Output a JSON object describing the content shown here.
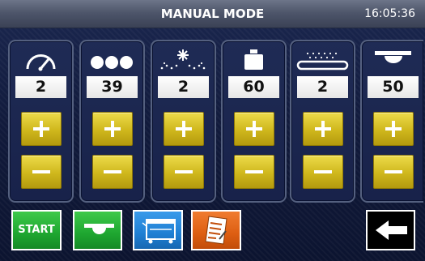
{
  "header": {
    "title": "MANUAL MODE",
    "time": "16:05:36"
  },
  "panels": [
    {
      "icon": "speedometer-icon",
      "value": "2"
    },
    {
      "icon": "rollers-icon",
      "value": "39"
    },
    {
      "icon": "spray-icon",
      "value": "2"
    },
    {
      "icon": "weight-icon",
      "value": "60"
    },
    {
      "icon": "belt-icon",
      "value": "2"
    },
    {
      "icon": "press-icon",
      "value": "50"
    }
  ],
  "footer": {
    "start_label": "START",
    "conveyor_icon": "conveyor-icon",
    "machine_icon": "machine-icon",
    "report_icon": "report-icon",
    "back_icon": "arrow-left-icon"
  },
  "colors": {
    "background": "#131d42",
    "titlebar": "#555d72",
    "adjust_button": "#d7c125",
    "start_green": "#1ea630",
    "machine_blue": "#1f7fd3",
    "report_orange": "#dd5e12"
  }
}
